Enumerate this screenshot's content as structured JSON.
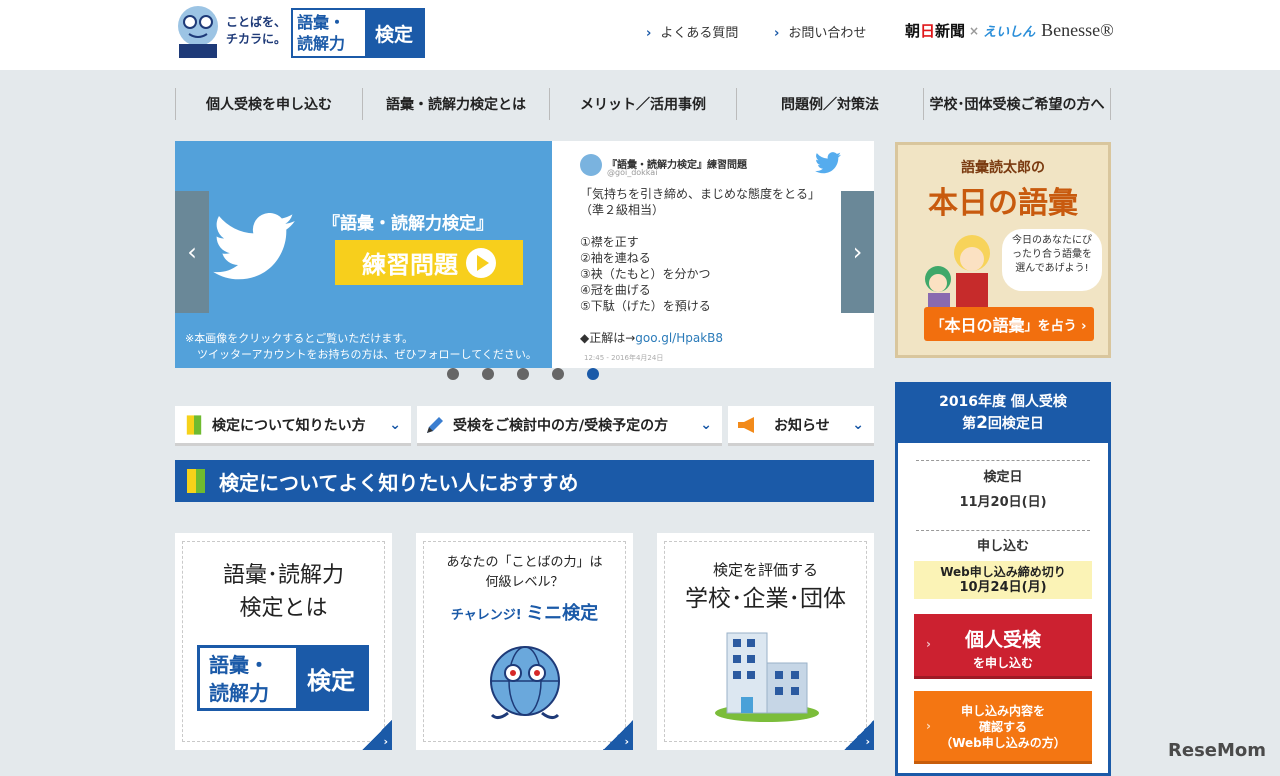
{
  "header": {
    "logo_tagline_1": "ことばを、",
    "logo_tagline_2": "チカラに。",
    "logo_label_1": "語彙・",
    "logo_label_2": "読解力",
    "logo_badge": "検定",
    "links": [
      "よくある質問",
      "お問い合わせ"
    ],
    "partner_1_a": "朝",
    "partner_1_b": "日",
    "partner_1_c": "新聞",
    "partner_sep": "×",
    "partner_2": "えいしん",
    "partner_3": "Benesse®"
  },
  "nav": {
    "items": [
      "個人受検を申し込む",
      "語彙・読解力検定とは",
      "メリット／活用事例",
      "問題例／対策法",
      "学校･団体受検ご希望の方へ"
    ]
  },
  "slider": {
    "title": "『語彙・読解力検定』",
    "button": "練習問題",
    "note_1": "※本画像をクリックするとご覧いただけます。",
    "note_2": "ツイッターアカウントをお持ちの方は、ぜひフォローしてください。",
    "tweet_name": "『語彙・読解力検定』練習問題",
    "tweet_handle": "@goi_dokkai",
    "tweet_lines": [
      "「気持ちを引き締め、まじめな態度をとる」",
      "（準２級相当）",
      "",
      "①襟を正す",
      "②袖を連ねる",
      "③袂（たもと）を分かつ",
      "④冠を曲げる",
      "⑤下駄（げた）を預ける",
      ""
    ],
    "tweet_answer_prefix": "◆正解は→",
    "tweet_answer_link": "goo.gl/HpakB8",
    "tweet_time": "12:45 - 2016年4月24日",
    "prev": "‹",
    "next": "›",
    "active_index": 4
  },
  "goi_box": {
    "head": "語彙読太郎の",
    "title": "本日の語彙",
    "bubble": "今日のあなたにぴったり合う語彙を選んであげよう!",
    "button_pre": "「",
    "button_big": "本日の語彙",
    "button_post": "」を占う ›"
  },
  "tabs": [
    "検定について知りたい方",
    "受検をご検討中の方/受検予定の方",
    "お知らせ"
  ],
  "section_title": "検定についてよく知りたい人におすすめ",
  "cards": {
    "c1_line1": "語彙･読解力",
    "c1_line2": "検定とは",
    "c1_logo_1": "語彙・",
    "c1_logo_2": "読解力",
    "c1_logo_badge": "検定",
    "c2_line1": "あなたの「ことばの力」は",
    "c2_line2": "何級レベル？",
    "c2_sub_small": "チャレンジ! ",
    "c2_sub_big": "ミニ検定",
    "c3_line1": "検定を評価する",
    "c3_line2": "学校･企業･団体"
  },
  "sidebar": {
    "head_1": "2016年度 個人受検",
    "head_2_pre": "第",
    "head_2_num": "2",
    "head_2_post": "回検定日",
    "exam_label": "検定日",
    "exam_date": "11月20日(日)",
    "apply_label": "申し込む",
    "deadline_label": "Web申し込み締め切り",
    "deadline_date": "10月24日(月)",
    "btn1_a": "個人受検",
    "btn1_b": "を申し込む",
    "btn2_1": "申し込み内容を",
    "btn2_2": "確認する",
    "btn2_3": "（Web申し込みの方）"
  },
  "watermark": "ReseMom",
  "colors": {
    "brand_blue": "#1b5aa8",
    "twitter_blue": "#53a1da",
    "red": "#cc2130",
    "orange": "#f47612"
  }
}
